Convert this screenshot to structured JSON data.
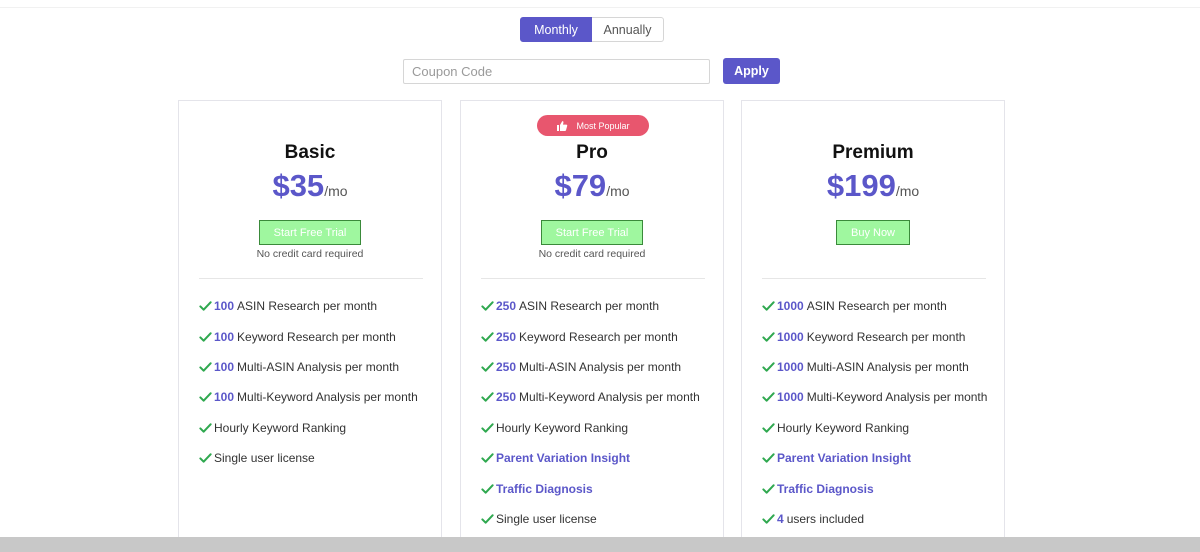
{
  "billing_toggle": {
    "monthly": "Monthly",
    "annually": "Annually",
    "selected": "Monthly"
  },
  "coupon": {
    "placeholder": "Coupon Code",
    "apply": "Apply"
  },
  "plans": [
    {
      "name": "Basic",
      "price": "$35",
      "period": "/mo",
      "cta": "Start Free Trial",
      "note": "No credit card required",
      "features": [
        {
          "num": "100",
          "text": "ASIN Research per month"
        },
        {
          "num": "100",
          "text": "Keyword Research per month"
        },
        {
          "num": "100",
          "text": "Multi-ASIN Analysis per month"
        },
        {
          "num": "100",
          "text": "Multi-Keyword Analysis per month"
        },
        {
          "num": "",
          "text": "Hourly Keyword Ranking"
        },
        {
          "num": "",
          "text": "Single user license"
        }
      ]
    },
    {
      "name": "Pro",
      "badge": "Most Popular",
      "price": "$79",
      "period": "/mo",
      "cta": "Start Free Trial",
      "note": "No credit card required",
      "features": [
        {
          "num": "250",
          "text": "ASIN Research per month"
        },
        {
          "num": "250",
          "text": "Keyword Research per month"
        },
        {
          "num": "250",
          "text": "Multi-ASIN Analysis per month"
        },
        {
          "num": "250",
          "text": "Multi-Keyword Analysis per month"
        },
        {
          "num": "",
          "text": "Hourly Keyword Ranking"
        },
        {
          "highlight": "Parent Variation Insight"
        },
        {
          "highlight": "Traffic Diagnosis"
        },
        {
          "num": "",
          "text": "Single user license"
        }
      ]
    },
    {
      "name": "Premium",
      "price": "$199",
      "period": "/mo",
      "cta": "Buy Now",
      "features": [
        {
          "num": "1000",
          "text": "ASIN Research per month"
        },
        {
          "num": "1000",
          "text": "Keyword Research per month"
        },
        {
          "num": "1000",
          "text": "Multi-ASIN Analysis per month"
        },
        {
          "num": "1000",
          "text": "Multi-Keyword Analysis per month"
        },
        {
          "num": "",
          "text": "Hourly Keyword Ranking"
        },
        {
          "highlight": "Parent Variation Insight"
        },
        {
          "highlight": "Traffic Diagnosis"
        },
        {
          "num": "4",
          "text": "users included"
        }
      ]
    }
  ],
  "colors": {
    "accent": "#5b57c9",
    "badge": "#e8566e",
    "check": "#2fa84f",
    "cta_bg": "#9ff79f",
    "cta_border": "#3a8a3a"
  }
}
